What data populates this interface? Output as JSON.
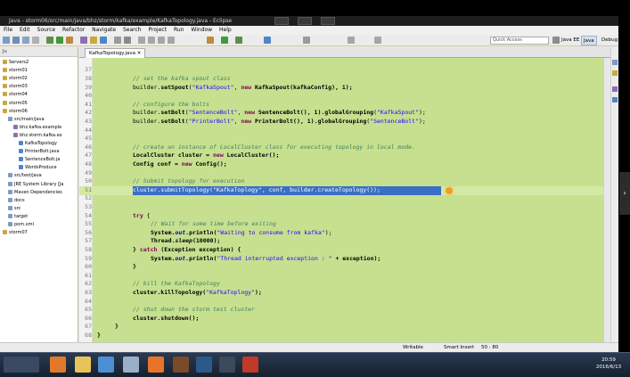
{
  "window": {
    "title": "Java - storm06/src/main/java/bhz/storm/kafka/example/KafkaTopology.java - Eclipse"
  },
  "menu": {
    "items": [
      "File",
      "Edit",
      "Source",
      "Refactor",
      "Navigate",
      "Search",
      "Project",
      "Run",
      "Window",
      "Help"
    ]
  },
  "toolbar": {
    "quick_access_placeholder": "Quick Access",
    "perspectives": [
      "Java EE",
      "Java",
      "Debug"
    ]
  },
  "explorer": {
    "header": "Ju",
    "items": [
      {
        "label": "Servers2",
        "indent": 0
      },
      {
        "label": "storm01",
        "indent": 0
      },
      {
        "label": "storm02",
        "indent": 0
      },
      {
        "label": "storm03",
        "indent": 0
      },
      {
        "label": "storm04",
        "indent": 0
      },
      {
        "label": "storm05",
        "indent": 0
      },
      {
        "label": "storm06",
        "indent": 0
      },
      {
        "label": "src/main/java",
        "indent": 1
      },
      {
        "label": "bhz.kafka.example",
        "indent": 2
      },
      {
        "label": "bhz.storm.kafka.ex",
        "indent": 2
      },
      {
        "label": "KafkaTopology",
        "indent": 3
      },
      {
        "label": "PrinterBolt.java",
        "indent": 3
      },
      {
        "label": "SentenceBolt.ja",
        "indent": 3
      },
      {
        "label": "WordsProduce",
        "indent": 3
      },
      {
        "label": "src/test/java",
        "indent": 1
      },
      {
        "label": "JRE System Library [Ja",
        "indent": 1
      },
      {
        "label": "Maven Dependencies",
        "indent": 1
      },
      {
        "label": "docs",
        "indent": 1
      },
      {
        "label": "src",
        "indent": 1
      },
      {
        "label": "target",
        "indent": 1
      },
      {
        "label": "pom.xml",
        "indent": 1
      },
      {
        "label": "storm07",
        "indent": 0
      }
    ]
  },
  "editor": {
    "tab_label": "KafkaTopology.java",
    "line_numbers": [
      "37",
      "38",
      "39",
      "40",
      "41",
      "42",
      "43",
      "44",
      "45",
      "46",
      "47",
      "48",
      "49",
      "50",
      "51",
      "52",
      "53",
      "54",
      "55",
      "56",
      "57",
      "58",
      "59",
      "60",
      "61",
      "62",
      "63",
      "64",
      "65",
      "66",
      "67",
      "68"
    ],
    "code": {
      "l37": "// set the kafka spout class",
      "l38a": "builder.",
      "l38b": "setSpout",
      "l38c": "(",
      "l38d": "\"KafkaSpout\"",
      "l38e": ", ",
      "l38f": "new",
      "l38g": " KafkaSpout(kafkaConfig), 1);",
      "l40": "// configure the bolts",
      "l41a": "builder.",
      "l41b": "setBolt",
      "l41c": "(",
      "l41d": "\"SentenceBolt\"",
      "l41e": ", ",
      "l41f": "new",
      "l41g": " SentenceBolt(), 1).",
      "l41h": "globalGrouping",
      "l41i": "(",
      "l41j": "\"KafkaSpout\"",
      "l41k": ");",
      "l42a": "builder.",
      "l42b": "setBolt",
      "l42c": "(",
      "l42d": "\"PrinterBolt\"",
      "l42e": ", ",
      "l42f": "new",
      "l42g": " PrinterBolt(), 1).",
      "l42h": "globalGrouping",
      "l42i": "(",
      "l42j": "\"SentenceBolt\"",
      "l42k": ");",
      "l45": "// create an instance of LocalCluster class for executing topology in local mode.",
      "l46a": "LocalCluster cluster = ",
      "l46b": "new",
      "l46c": " LocalCluster();",
      "l47a": "Config conf = ",
      "l47b": "new",
      "l47c": " Config();",
      "l49": "// Submit topology for execution",
      "l50a": "cluster.submitTopology(",
      "l50b": "\"KafkaToplogy\"",
      "l50c": ", conf, builder.createTopology());",
      "l53a": "try",
      "l53b": " {",
      "l54": "// Wait for some time before exiting",
      "l55a": "System.",
      "l55b": "out",
      "l55c": ".println(",
      "l55d": "\"Waiting to consume from kafka\"",
      "l55e": ");",
      "l56a": "Thread.",
      "l56b": "sleep",
      "l56c": "(10000);",
      "l57a": "} ",
      "l57b": "catch",
      "l57c": " (Exception exception) {",
      "l58a": "System.",
      "l58b": "out",
      "l58c": ".println(",
      "l58d": "\"Thread interrupted exception : \"",
      "l58e": " + exception);",
      "l59": "}",
      "l61": "// kill the KafkaTopology",
      "l62a": "cluster.killTopology(",
      "l62b": "\"KafkaToplogy\"",
      "l62c": ");",
      "l64": "// shut down the storm test cluster",
      "l65": "cluster.shutdown();",
      "l66": "}",
      "l67": "}"
    }
  },
  "status": {
    "writable": "Writable",
    "insert_mode": "Smart Insert",
    "position": "50 : 80"
  },
  "taskbar": {
    "time": "20:59",
    "date": "2016/6/13"
  },
  "colors": {
    "editor_bg": "#c6e08f",
    "comment": "#3f7f5f",
    "string": "#2a00ff",
    "keyword": "#7f0055",
    "selection": "#3b6fc4"
  }
}
